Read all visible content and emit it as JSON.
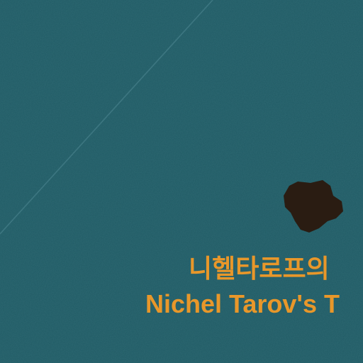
{
  "map": {
    "place": {
      "name_ko": "니헬타로프의",
      "name_en": "Nichel Tarov's T"
    },
    "colors": {
      "water": "#1f5a64",
      "island": "#2a1c12",
      "label": "#e8972a",
      "track_line": "#4f8893"
    }
  }
}
